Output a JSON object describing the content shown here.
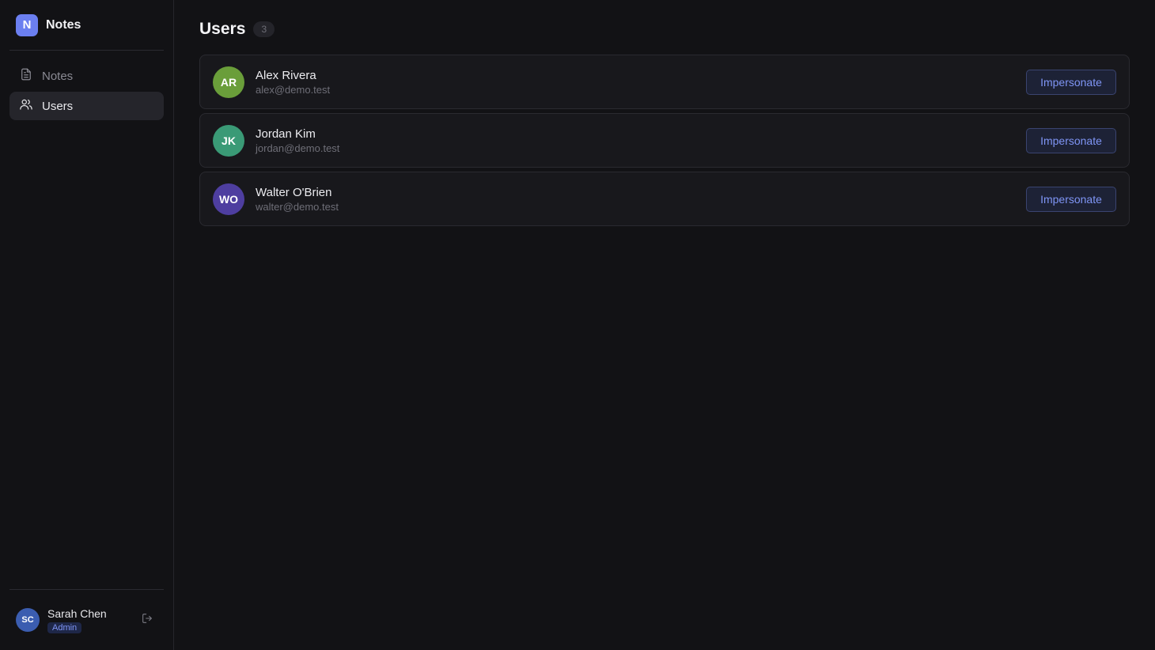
{
  "app": {
    "logo_letter": "N",
    "name": "Notes"
  },
  "sidebar": {
    "items": [
      {
        "label": "Notes",
        "icon": "document-icon",
        "active": false
      },
      {
        "label": "Users",
        "icon": "users-icon",
        "active": true
      }
    ]
  },
  "current_user": {
    "initials": "SC",
    "name": "Sarah Chen",
    "role": "Admin",
    "avatar_color": "#3b5db0"
  },
  "main": {
    "title": "Users",
    "count": "3",
    "users": [
      {
        "initials": "AR",
        "name": "Alex Rivera",
        "email": "alex@demo.test",
        "avatar_color": "#6a9e3a",
        "action": "Impersonate"
      },
      {
        "initials": "JK",
        "name": "Jordan Kim",
        "email": "jordan@demo.test",
        "avatar_color": "#3a9a76",
        "action": "Impersonate"
      },
      {
        "initials": "WO",
        "name": "Walter O'Brien",
        "email": "walter@demo.test",
        "avatar_color": "#4e3ea0",
        "action": "Impersonate"
      }
    ]
  },
  "colors": {
    "accent": "#6b7ff0",
    "background": "#121215",
    "card": "#18181c"
  }
}
